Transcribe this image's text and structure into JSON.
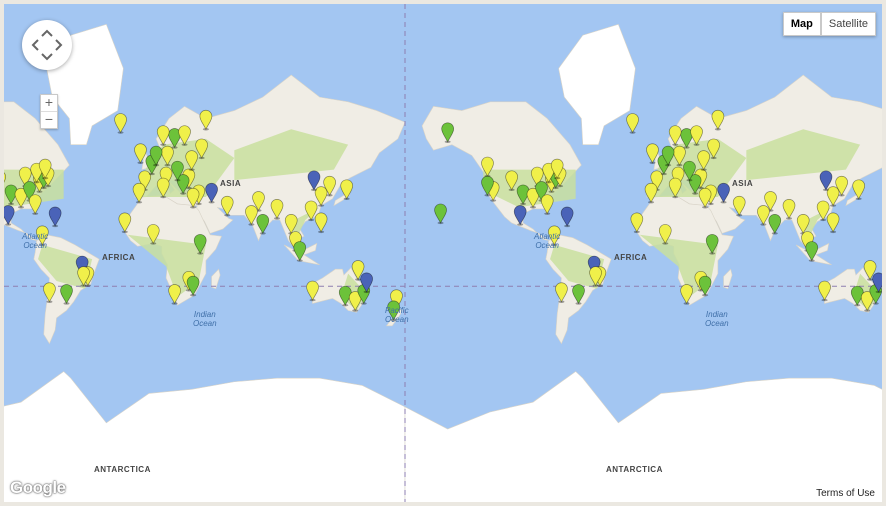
{
  "map_type": {
    "map_label": "Map",
    "satellite_label": "Satellite",
    "selected": "Map"
  },
  "zoom": {
    "in_label": "+",
    "out_label": "−"
  },
  "terms_label": "Terms of Use",
  "logo_text": "Google",
  "ocean_labels": {
    "atlantic_left": "Atlantic\nOcean",
    "atlantic_mid": "Atlantic\nOcean",
    "indian_left": "Indian\nOcean",
    "indian_right": "Indian\nOcean",
    "pacific": "Pacific\nOcean"
  },
  "land_labels": {
    "asia_left": "ASIA",
    "asia_right": "ASIA",
    "africa_left": "AFRICA",
    "africa_right": "AFRICA",
    "antarctica_left": "ANTARCTICA",
    "antarctica_right": "ANTARCTICA"
  },
  "colors": {
    "water": "#a3c6f2",
    "land": "#f0ede5",
    "vegetation": "#c9df9f",
    "ice": "#ffffff",
    "marker_yellow": "#f0f04a",
    "marker_green": "#6cc23a",
    "marker_blue": "#4a63b8"
  },
  "markers": [
    {
      "lon": -150,
      "lat": 61,
      "color": "green"
    },
    {
      "lon": -122,
      "lat": 47,
      "color": "yellow"
    },
    {
      "lon": -118,
      "lat": 34,
      "color": "yellow"
    },
    {
      "lon": -122,
      "lat": 37,
      "color": "green"
    },
    {
      "lon": -105,
      "lat": 40,
      "color": "yellow"
    },
    {
      "lon": -97,
      "lat": 32,
      "color": "green"
    },
    {
      "lon": -90,
      "lat": 30,
      "color": "yellow"
    },
    {
      "lon": -87,
      "lat": 42,
      "color": "yellow"
    },
    {
      "lon": -84,
      "lat": 34,
      "color": "green"
    },
    {
      "lon": -80,
      "lat": 26,
      "color": "yellow"
    },
    {
      "lon": -77,
      "lat": 39,
      "color": "yellow"
    },
    {
      "lon": -74,
      "lat": 41,
      "color": "green"
    },
    {
      "lon": -71,
      "lat": 42,
      "color": "yellow"
    },
    {
      "lon": -79,
      "lat": 44,
      "color": "yellow"
    },
    {
      "lon": -73,
      "lat": 46,
      "color": "yellow"
    },
    {
      "lon": -99,
      "lat": 19,
      "color": "blue"
    },
    {
      "lon": -155,
      "lat": 20,
      "color": "green"
    },
    {
      "lon": -66,
      "lat": 18,
      "color": "blue"
    },
    {
      "lon": -75,
      "lat": 5,
      "color": "yellow"
    },
    {
      "lon": -58,
      "lat": -34,
      "color": "green"
    },
    {
      "lon": -70,
      "lat": -33,
      "color": "yellow"
    },
    {
      "lon": -47,
      "lat": -16,
      "color": "blue"
    },
    {
      "lon": -43,
      "lat": -23,
      "color": "yellow"
    },
    {
      "lon": -46,
      "lat": -23,
      "color": "yellow"
    },
    {
      "lon": -3,
      "lat": 40,
      "color": "yellow"
    },
    {
      "lon": 2,
      "lat": 48,
      "color": "green"
    },
    {
      "lon": 13,
      "lat": 52,
      "color": "yellow"
    },
    {
      "lon": 12,
      "lat": 42,
      "color": "yellow"
    },
    {
      "lon": 18,
      "lat": 59,
      "color": "green"
    },
    {
      "lon": 37,
      "lat": 55,
      "color": "yellow"
    },
    {
      "lon": -6,
      "lat": 53,
      "color": "yellow"
    },
    {
      "lon": 28,
      "lat": 41,
      "color": "yellow"
    },
    {
      "lon": 24,
      "lat": 38,
      "color": "green"
    },
    {
      "lon": 35,
      "lat": 32,
      "color": "yellow"
    },
    {
      "lon": 31,
      "lat": 30,
      "color": "yellow"
    },
    {
      "lon": 55,
      "lat": 25,
      "color": "yellow"
    },
    {
      "lon": 44,
      "lat": 33,
      "color": "blue"
    },
    {
      "lon": 77,
      "lat": 28,
      "color": "yellow"
    },
    {
      "lon": 72,
      "lat": 19,
      "color": "yellow"
    },
    {
      "lon": 80,
      "lat": 13,
      "color": "green"
    },
    {
      "lon": 90,
      "lat": 23,
      "color": "yellow"
    },
    {
      "lon": 100,
      "lat": 13,
      "color": "yellow"
    },
    {
      "lon": 103,
      "lat": 1,
      "color": "yellow"
    },
    {
      "lon": 106,
      "lat": -6,
      "color": "green"
    },
    {
      "lon": 114,
      "lat": 22,
      "color": "yellow"
    },
    {
      "lon": 121,
      "lat": 31,
      "color": "yellow"
    },
    {
      "lon": 116,
      "lat": 40,
      "color": "blue"
    },
    {
      "lon": 127,
      "lat": 37,
      "color": "yellow"
    },
    {
      "lon": 139,
      "lat": 35,
      "color": "yellow"
    },
    {
      "lon": 121,
      "lat": 14,
      "color": "yellow"
    },
    {
      "lon": 115,
      "lat": -32,
      "color": "yellow"
    },
    {
      "lon": 138,
      "lat": -35,
      "color": "green"
    },
    {
      "lon": 145,
      "lat": -38,
      "color": "yellow"
    },
    {
      "lon": 151,
      "lat": -34,
      "color": "green"
    },
    {
      "lon": 153,
      "lat": -27,
      "color": "blue"
    },
    {
      "lon": 147,
      "lat": -19,
      "color": "yellow"
    },
    {
      "lon": 174,
      "lat": -37,
      "color": "yellow"
    },
    {
      "lon": 172,
      "lat": -43,
      "color": "green"
    },
    {
      "lon": 28,
      "lat": -26,
      "color": "yellow"
    },
    {
      "lon": 18,
      "lat": -34,
      "color": "yellow"
    },
    {
      "lon": 31,
      "lat": -29,
      "color": "green"
    },
    {
      "lon": 36,
      "lat": -1,
      "color": "green"
    },
    {
      "lon": 3,
      "lat": 6,
      "color": "yellow"
    },
    {
      "lon": -17,
      "lat": 14,
      "color": "yellow"
    },
    {
      "lon": -7,
      "lat": 33,
      "color": "yellow"
    },
    {
      "lon": 10,
      "lat": 36,
      "color": "yellow"
    },
    {
      "lon": 25,
      "lat": 60,
      "color": "yellow"
    },
    {
      "lon": 5,
      "lat": 52,
      "color": "green"
    },
    {
      "lon": -20,
      "lat": 64,
      "color": "yellow"
    },
    {
      "lon": 10,
      "lat": 60,
      "color": "yellow"
    },
    {
      "lon": 30,
      "lat": 50,
      "color": "yellow"
    },
    {
      "lon": 40,
      "lat": 65,
      "color": "yellow"
    },
    {
      "lon": 20,
      "lat": 45,
      "color": "green"
    }
  ]
}
